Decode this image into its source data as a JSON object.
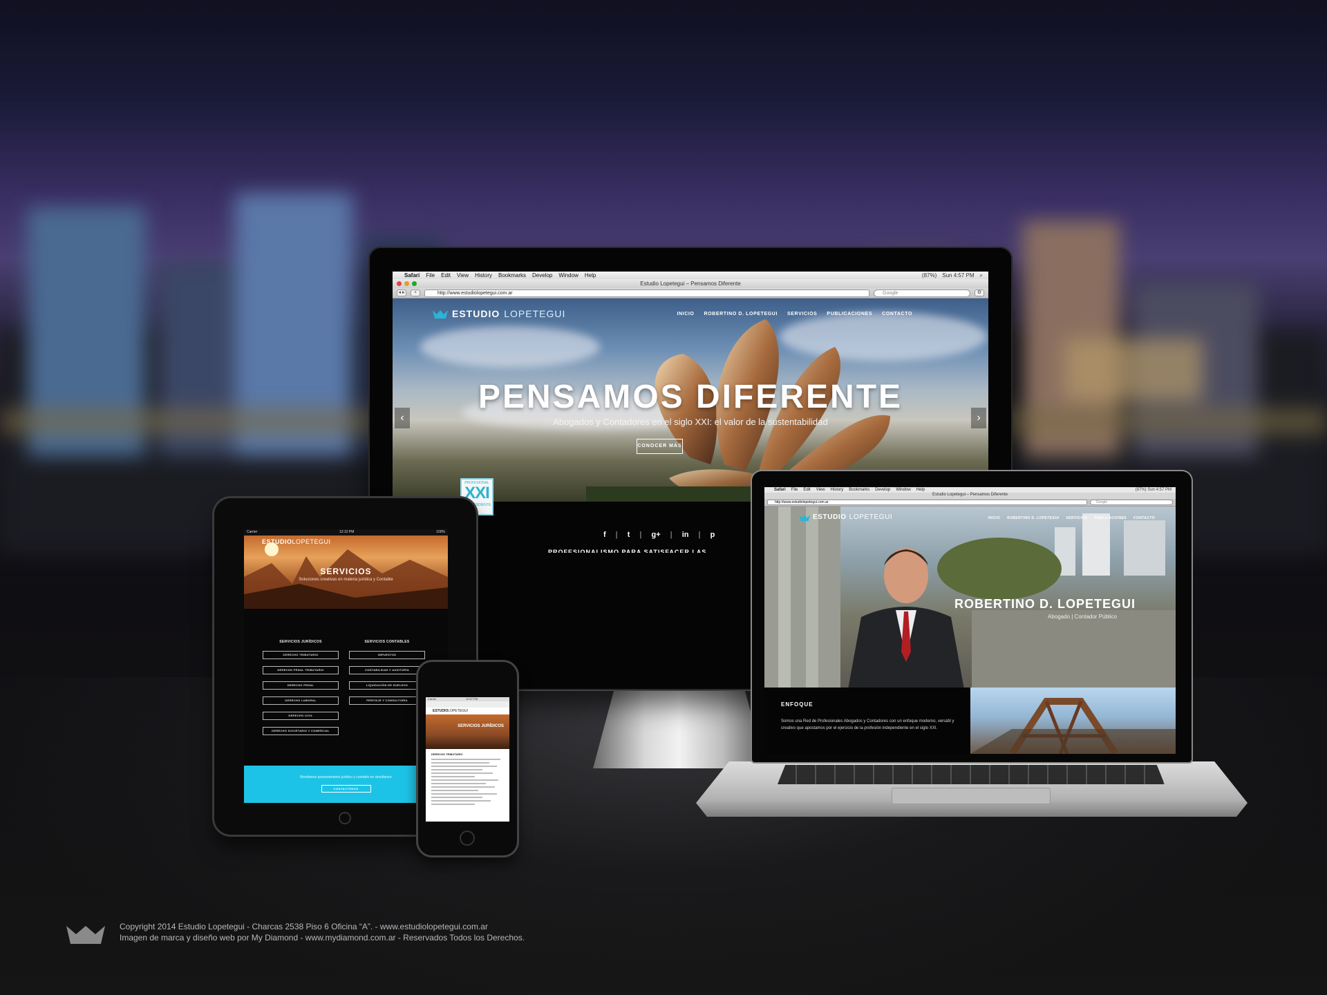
{
  "colors": {
    "accent": "#1dc3e6",
    "brand": "#28b8d8"
  },
  "imac": {
    "menubar": {
      "apple": "",
      "app": "Safari",
      "items": [
        "File",
        "Edit",
        "View",
        "History",
        "Bookmarks",
        "Develop",
        "Window",
        "Help"
      ],
      "battery": "(87%)",
      "clock": "Sun 4:57 PM"
    },
    "window_title": "Estudio Lopetegui – Pensamos Diferente",
    "url": "http://www.estudiolopetegui.com.ar",
    "search_placeholder": "Google",
    "site": {
      "logo_bold": "ESTUDIO",
      "logo_thin": "LOPETEGUI",
      "nav": [
        "INICIO",
        "ROBERTINO D. LOPETEGUI",
        "SERVICIOS",
        "PUBLICACIONES",
        "CONTACTO"
      ],
      "hero_title": "PENSAMOS DIFERENTE",
      "hero_subtitle": "Abogados y Contadores en el siglo XXI: el valor de la sustentabilidad",
      "hero_button": "CONOCER MÁS",
      "arrow_left": "‹",
      "arrow_right": "›",
      "social": [
        "f",
        "t",
        "g+",
        "in",
        "p"
      ],
      "band_text": "PROFESIONALISMO PARA SATISFACER LAS NECESIDADES",
      "badge_top": "PROFESIONAL",
      "badge_main": "XXI",
      "badge_bottom": "INDEPENDIENTE"
    }
  },
  "ipad": {
    "status_left": "Carrier",
    "status_time": "12:12 PM",
    "status_right": "100%",
    "logo_bold": "ESTUDIO",
    "logo_thin": "LOPETEGUI",
    "title": "SERVICIOS",
    "subtitle": "Soluciones creativas en materia jurídica y Contable",
    "col_left_title": "SERVICIOS JURÍDICOS",
    "col_left": [
      "DERECHO TRIBUTARIO",
      "DERECHO PENAL TRIBUTARIO",
      "DERECHO PENAL",
      "DERECHO LABORAL",
      "DERECHO CIVIL",
      "DERECHO SOCIETARIO Y COMERCIAL"
    ],
    "col_right_title": "SERVICIOS CONTABLES",
    "col_right": [
      "IMPUESTOS",
      "CONTABILIDAD Y AUDITORÍA",
      "LIQUIDACIÓN DE SUELDOS",
      "PERITAJE Y CONSULTORÍA"
    ],
    "cta_text": "Brindamos asesoramiento jurídico y contable en simultaneo",
    "cta_button": "CONTACTENOS"
  },
  "iphone": {
    "status_left": "Carrier",
    "status_time": "10:57 PM",
    "logo_bold": "ESTUDIO",
    "logo_thin": "LOPETEGUI",
    "hero_title": "SERVICIOS JURÍDICOS",
    "section_title": "DERECHO TRIBUTARIO"
  },
  "macbook": {
    "menubar": {
      "app": "Safari",
      "items": [
        "File",
        "Edit",
        "View",
        "History",
        "Bookmarks",
        "Develop",
        "Window",
        "Help"
      ],
      "right": "(87%)  Sun 4:57 PM"
    },
    "window_title": "Estudio Lopetegui – Pensamos Diferente",
    "url": "http://www.estudiolopetegui.com.ar",
    "search_placeholder": "Google",
    "site": {
      "logo_bold": "ESTUDIO",
      "logo_thin": "LOPETEGUI",
      "nav": [
        "INICIO",
        "ROBERTINO D. LOPETEGUI",
        "SERVICIOS",
        "PUBLICACIONES",
        "CONTACTO"
      ],
      "name": "ROBERTINO D. LOPETEGUI",
      "role": "Abogado | Contador Público",
      "section_title": "ENFOQUE",
      "section_text": "Somos una Red de Profesionales Abogados y Contadores con un enfoque moderno, versátil y creativo que apostamos por el ejercicio de la profesión independiente en el siglo XXI."
    }
  },
  "footer": {
    "line1": "Copyright 2014 Estudio Lopetegui - Charcas 2538 Piso 6 Oficina “A”.  - www.estudiolopetegui.com.ar",
    "line2": "Imagen de marca y diseño web por My Diamond - www.mydiamond.com.ar - Reservados Todos los Derechos."
  }
}
